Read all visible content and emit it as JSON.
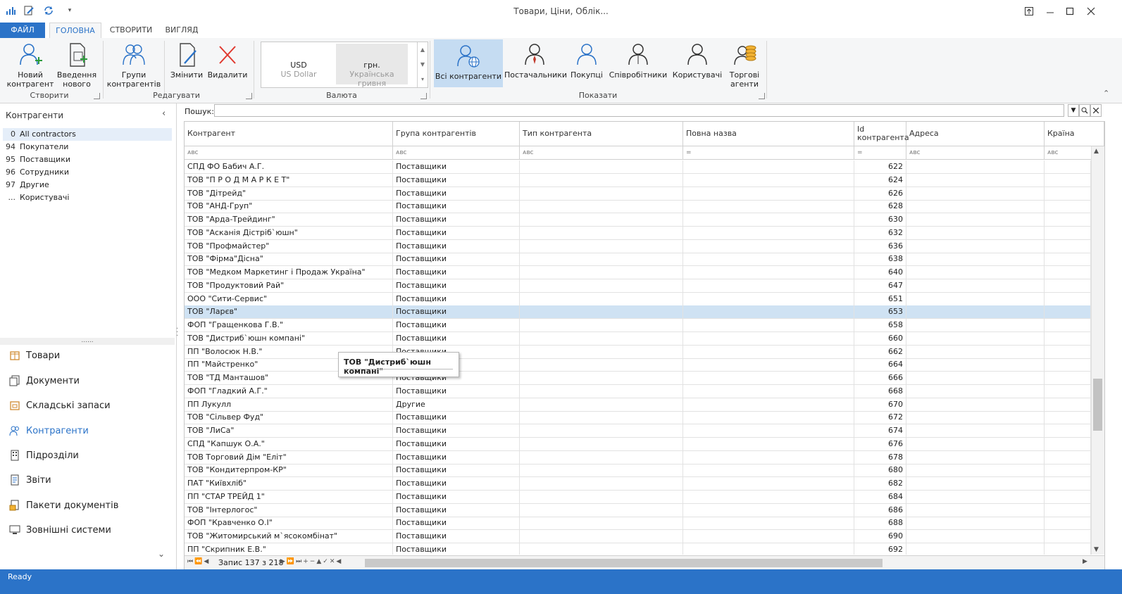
{
  "window": {
    "title": "Товари, Ціни, Облік..."
  },
  "tabs": [
    {
      "label": "ФАЙЛ"
    },
    {
      "label": "ГОЛОВНА"
    },
    {
      "label": "СТВОРИТИ"
    },
    {
      "label": "ВИГЛЯД"
    }
  ],
  "ribbon": {
    "new_counterparty": "Новий\nконтрагент",
    "enter_new": "Введення\nнового",
    "groups_btn": "Групи\nконтрагентів",
    "edit": "Змінити",
    "delete": "Видалити",
    "group_create": "Створити",
    "group_edit": "Редагувати",
    "group_currency": "Валюта",
    "group_show": "Показати",
    "currency": [
      {
        "code": "USD",
        "name": "US Dollar"
      },
      {
        "code": "грн.",
        "name": "Українська гривня"
      }
    ],
    "show_buttons": [
      {
        "label": "Всі контрагенти"
      },
      {
        "label": "Постачальники"
      },
      {
        "label": "Покупці"
      },
      {
        "label": "Співробітники"
      },
      {
        "label": "Користувачі"
      },
      {
        "label": "Торгові\nагенти"
      }
    ]
  },
  "left_panel": {
    "title": "Контрагенти",
    "tree": [
      {
        "num": "0",
        "label": "All contractors"
      },
      {
        "num": "94",
        "label": "Покупатели"
      },
      {
        "num": "95",
        "label": "Поставщики"
      },
      {
        "num": "96",
        "label": "Сотрудники"
      },
      {
        "num": "97",
        "label": "Другие"
      },
      {
        "num": "...",
        "label": "Користувачі"
      }
    ],
    "nav": [
      {
        "label": "Товари"
      },
      {
        "label": "Документи"
      },
      {
        "label": "Складські запаси"
      },
      {
        "label": "Контрагенти"
      },
      {
        "label": "Підрозділи"
      },
      {
        "label": "Звіти"
      },
      {
        "label": "Пакети документів"
      },
      {
        "label": "Зовнішні системи"
      }
    ]
  },
  "search": {
    "label": "Пошук:",
    "value": ""
  },
  "grid": {
    "columns": [
      "Контрагент",
      "Група контрагентів",
      "Тип контрагента",
      "Повна назва",
      "Id\nконтрагента",
      "Адреса",
      "Країна"
    ],
    "rows": [
      {
        "name": "СПД ФО Бабич А.Г.",
        "group": "Поставщики",
        "id": "622"
      },
      {
        "name": "ТОВ \"П Р О Д М А Р К Е Т\"",
        "group": "Поставщики",
        "id": "624"
      },
      {
        "name": "ТОВ \"Дітрейд\"",
        "group": "Поставщики",
        "id": "626"
      },
      {
        "name": "ТОВ \"АНД-Груп\"",
        "group": "Поставщики",
        "id": "628"
      },
      {
        "name": "ТОВ \"Арда-Трейдинг\"",
        "group": "Поставщики",
        "id": "630"
      },
      {
        "name": "ТОВ \"Асканія Дістріб`юшн\"",
        "group": "Поставщики",
        "id": "632"
      },
      {
        "name": "ТОВ \"Профмайстер\"",
        "group": "Поставщики",
        "id": "636"
      },
      {
        "name": "ТОВ \"Фірма\"Дісна\"",
        "group": "Поставщики",
        "id": "638"
      },
      {
        "name": "ТОВ \"Медком Маркетинг і Продаж Україна\"",
        "group": "Поставщики",
        "id": "640"
      },
      {
        "name": "ТОВ \"Продуктовий Рай\"",
        "group": "Поставщики",
        "id": "647"
      },
      {
        "name": "ООО \"Сити-Сервис\"",
        "group": "Поставщики",
        "id": "651"
      },
      {
        "name": "ТОВ \"Ларєв\"",
        "group": "Поставщики",
        "id": "653"
      },
      {
        "name": "ФОП \"Гращенкова Г.В.\"",
        "group": "Поставщики",
        "id": "658"
      },
      {
        "name": "ТОВ \"Дистриб`юшн компані\"",
        "group": "Поставщики",
        "id": "660"
      },
      {
        "name": "ПП \"Волосюк Н.В.\"",
        "group": "Поставщики",
        "id": "662"
      },
      {
        "name": "ПП \"Майстренко\"",
        "group": "Поставщики",
        "id": "664"
      },
      {
        "name": "ТОВ \"ТД Манташов\"",
        "group": "Поставщики",
        "id": "666"
      },
      {
        "name": "ФОП \"Гладкий А.Г.\"",
        "group": "Поставщики",
        "id": "668"
      },
      {
        "name": "ПП Лукулл",
        "group": "Другие",
        "id": "670"
      },
      {
        "name": "ТОВ \"Сільвер Фуд\"",
        "group": "Поставщики",
        "id": "672"
      },
      {
        "name": "ТОВ \"ЛиСа\"",
        "group": "Поставщики",
        "id": "674"
      },
      {
        "name": "СПД \"Капшук О.А.\"",
        "group": "Поставщики",
        "id": "676"
      },
      {
        "name": "ТОВ Торговий Дім \"Еліт\"",
        "group": "Поставщики",
        "id": "678"
      },
      {
        "name": "ТОВ \"Кондитерпром-КР\"",
        "group": "Поставщики",
        "id": "680"
      },
      {
        "name": "ПАТ \"Київхліб\"",
        "group": "Поставщики",
        "id": "682"
      },
      {
        "name": "ПП \"СТАР ТРЕЙД 1\"",
        "group": "Поставщики",
        "id": "684"
      },
      {
        "name": "ТОВ \"Інтерлогос\"",
        "group": "Поставщики",
        "id": "686"
      },
      {
        "name": "ФОП \"Кравченко О.І\"",
        "group": "Поставщики",
        "id": "688"
      },
      {
        "name": "ТОВ \"Житомирський м`ясокомбінат\"",
        "group": "Поставщики",
        "id": "690"
      },
      {
        "name": "ПП \"Скрипник Е.В.\"",
        "group": "Поставщики",
        "id": "692"
      }
    ],
    "selected_row": 11,
    "record_text": "Запис 137 з 218"
  },
  "tooltip": {
    "text": "ТОВ \"Дистриб`юшн компані\""
  },
  "status": {
    "text": "Ready"
  },
  "colors": {
    "accent": "#2b73c8",
    "selection": "#cfe2f3",
    "ribbon_bg": "#f5f6f7"
  }
}
